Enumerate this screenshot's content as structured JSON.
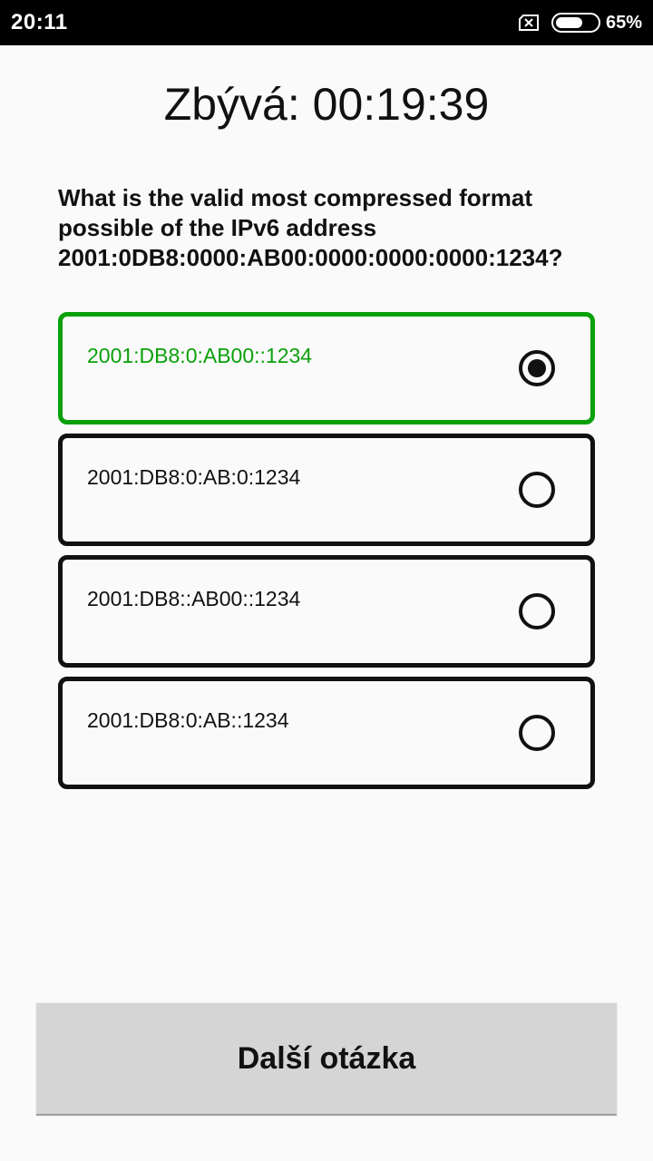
{
  "status_bar": {
    "time": "20:11",
    "battery_percent": "65%",
    "battery_level": 0.65,
    "icons": [
      "sim-off-icon",
      "battery-icon"
    ]
  },
  "timer": {
    "text": "Zbývá: 00:19:39"
  },
  "question": {
    "lines": [
      "What is the valid most compressed format",
      "possible of the IPv6 address",
      "2001:0DB8:0000:AB00:0000:0000:0000:1234?"
    ]
  },
  "options": [
    {
      "label": "2001:DB8:0:AB00::1234",
      "selected": true
    },
    {
      "label": "2001:DB8:0:AB:0:1234",
      "selected": false
    },
    {
      "label": "2001:DB8::AB00::1234",
      "selected": false
    },
    {
      "label": "2001:DB8:0:AB::1234",
      "selected": false
    }
  ],
  "next_button": {
    "label": "Další otázka"
  },
  "colors": {
    "correct_accent": "#0aa00a",
    "border": "#111111",
    "background": "#fafafa",
    "button_bg": "#d5d5d5",
    "status_bar_bg": "#000000"
  }
}
